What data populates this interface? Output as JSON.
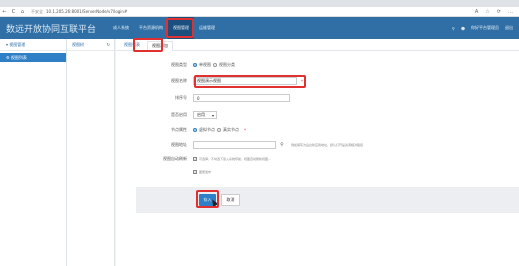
{
  "browser": {
    "url": "10.1.205.26:8001/ServerNode/v7/login#",
    "insecure_label": "不安全",
    "back_icon": "←",
    "refresh_icon": "C",
    "home_icon": "⌂",
    "toolbar_icons": [
      "A",
      "☆",
      "⟳",
      "…"
    ]
  },
  "header": {
    "title": "数远开放协同互联平台",
    "nav": [
      {
        "label": "成人系统"
      },
      {
        "label": "平台资源机构"
      },
      {
        "label": "视图管理",
        "active": true
      },
      {
        "label": "运维管理"
      }
    ],
    "right": {
      "user": "你好平台管理员",
      "logout": "退出"
    },
    "accent": "#2f6fa6"
  },
  "sidebar": {
    "title": "视图管理",
    "active_item": "视图列表"
  },
  "tree": {
    "title": "视图树",
    "refresh_icon": "↻"
  },
  "tabs": [
    {
      "label": "视图列表",
      "active": false
    },
    {
      "label": "视图添加",
      "active": true
    }
  ],
  "form": {
    "view_type": {
      "label": "视图类型",
      "options": [
        "单视图",
        "视图分类"
      ],
      "selected": "单视图"
    },
    "view_name": {
      "label": "视图名称",
      "value": "视图演示视图",
      "required_mark": "*"
    },
    "sort_order": {
      "label": "排序号",
      "value": "0"
    },
    "enabled": {
      "label": "是否启用",
      "value": "启用"
    },
    "node_attr": {
      "label": "节点属性",
      "options": [
        "虚拟节点",
        "真实节点"
      ],
      "selected": "虚拟节点",
      "required_mark": "*"
    },
    "view_url": {
      "label": "视图地址",
      "hint": "例如填写为后台新应用地址，默认打开是资源相对路径"
    },
    "auto_refresh": {
      "label": "视图自动刷新",
      "hint": "可选择，不勾选下载入系统导航，视图自动刷新视图..."
    },
    "publish_flag": {
      "label": "图册发布"
    }
  },
  "actions": {
    "save": "存入",
    "cancel": "取消"
  }
}
